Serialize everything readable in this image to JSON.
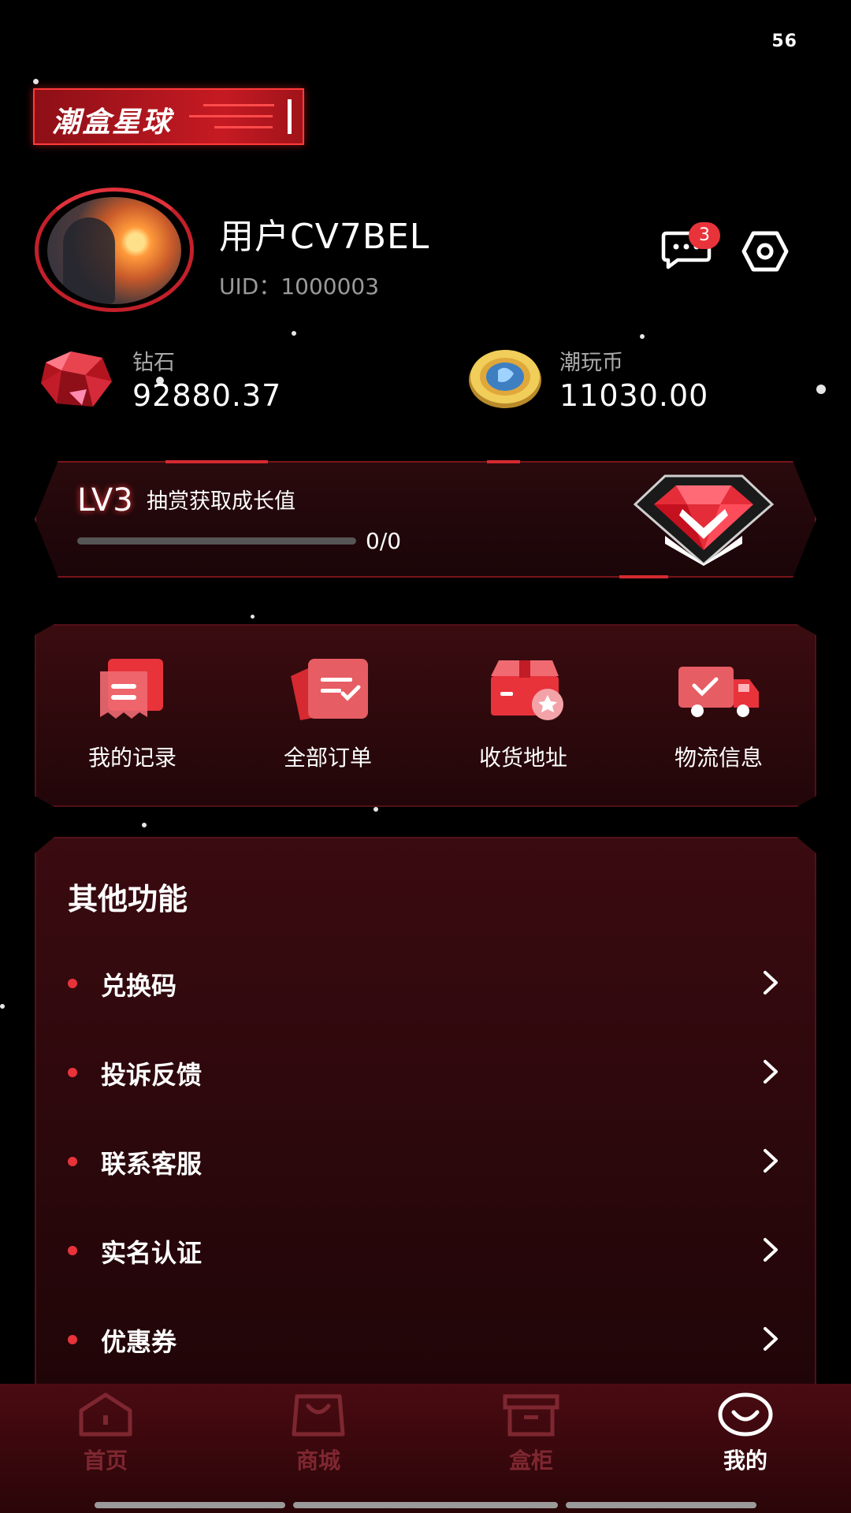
{
  "status_bar": {
    "time": "56"
  },
  "brand": {
    "logo_text": "潮盒星球"
  },
  "profile": {
    "username": "用户CV7BEL",
    "uid_label": "UID：",
    "uid": "1000003",
    "message_badge": "3"
  },
  "assets": {
    "diamond": {
      "label": "钻石",
      "value": "92880.37",
      "icon": "diamond-icon"
    },
    "coin": {
      "label": "潮玩币",
      "value": "11030.00",
      "icon": "coin-icon"
    }
  },
  "level": {
    "name": "LV3",
    "tip": "抽赏获取成长值",
    "progress_text": "0/0",
    "progress_fraction": 0
  },
  "shortcuts": [
    {
      "label": "我的记录",
      "icon": "record-icon"
    },
    {
      "label": "全部订单",
      "icon": "orders-icon"
    },
    {
      "label": "收货地址",
      "icon": "address-icon"
    },
    {
      "label": "物流信息",
      "icon": "logistics-truck-icon"
    }
  ],
  "other_functions": {
    "title": "其他功能",
    "items": [
      {
        "label": "兑换码"
      },
      {
        "label": "投诉反馈"
      },
      {
        "label": "联系客服"
      },
      {
        "label": "实名认证"
      },
      {
        "label": "优惠券"
      }
    ]
  },
  "tabbar": {
    "items": [
      {
        "label": "首页",
        "icon": "home-icon"
      },
      {
        "label": "商城",
        "icon": "shopping-bag-icon"
      },
      {
        "label": "盒柜",
        "icon": "box-cabinet-icon"
      },
      {
        "label": "我的",
        "icon": "smile-icon",
        "active": true
      }
    ]
  },
  "colors": {
    "accent": "#e8333b",
    "background": "#000000",
    "panel": "#3a0b10"
  }
}
